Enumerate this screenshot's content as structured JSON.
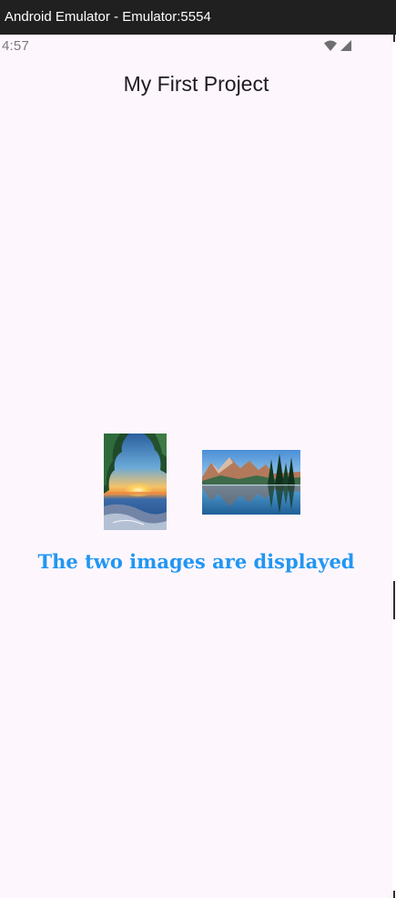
{
  "window": {
    "title": "Android Emulator - Emulator:5554"
  },
  "status_bar": {
    "time": "4:57",
    "icons": [
      "wifi-icon",
      "cellular-signal-icon"
    ]
  },
  "app_bar": {
    "title": "My First Project"
  },
  "images": [
    {
      "name": "sunset-beach-image",
      "subject": "sunset over the sea framed by trees"
    },
    {
      "name": "mountain-lake-image",
      "subject": "mountains reflected in a calm lake"
    }
  ],
  "caption": {
    "text": "The two images are displayed",
    "color": "#2196f3"
  },
  "colors": {
    "titlebar_bg": "#202020",
    "screen_bg": "#fdf6fd",
    "title_text": "#1d1b20"
  }
}
